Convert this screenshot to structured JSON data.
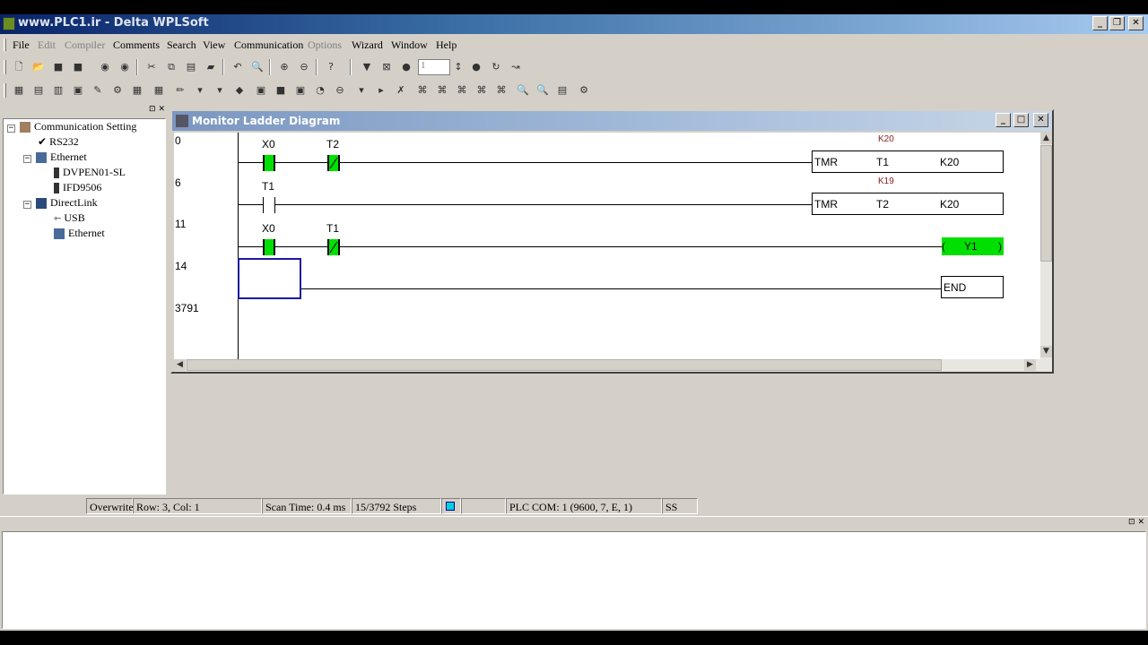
{
  "window": {
    "title": "www.PLC1.ir - Delta WPLSoft"
  },
  "menu": [
    {
      "label": "File",
      "enabled": true
    },
    {
      "label": "Edit",
      "enabled": false
    },
    {
      "label": "Compiler",
      "enabled": false
    },
    {
      "label": "Comments",
      "enabled": true
    },
    {
      "label": "Search",
      "enabled": true
    },
    {
      "label": "View",
      "enabled": true
    },
    {
      "label": "Communication",
      "enabled": true
    },
    {
      "label": "Options",
      "enabled": false
    },
    {
      "label": "Wizard",
      "enabled": true
    },
    {
      "label": "Window",
      "enabled": true
    },
    {
      "label": "Help",
      "enabled": true
    }
  ],
  "toolbar": {
    "step_value": "1"
  },
  "tree": {
    "root": "Communication Setting",
    "items": {
      "rs232": "RS232",
      "ethernet": "Ethernet",
      "dvpen": "DVPEN01-SL",
      "ifd": "IFD9506",
      "directlink": "DirectLink",
      "usb": "USB",
      "ethernet2": "Ethernet"
    }
  },
  "ladder": {
    "title": "Monitor Ladder Diagram",
    "rungs": {
      "r0": "0",
      "r1": "6",
      "r2": "11",
      "r3": "14",
      "r4": "3791"
    },
    "rung0": {
      "contact1": "X0",
      "contact2": "T2",
      "preset_value": "K20",
      "instr": "TMR",
      "operand": "T1",
      "setting": "K20"
    },
    "rung1": {
      "contact1": "T1",
      "preset_value": "K19",
      "instr": "TMR",
      "operand": "T2",
      "setting": "K20"
    },
    "rung2": {
      "contact1": "X0",
      "contact2": "T1",
      "coil": "Y1",
      "coil_left": "(",
      "coil_right": ")"
    },
    "end_label": "END"
  },
  "status": {
    "mode": "Overwrite",
    "position": "Row: 3, Col: 1",
    "scan_time": "Scan Time: 0.4 ms",
    "steps": "15/3792 Steps",
    "plc_com": "PLC COM: 1 (9600, 7, E, 1)",
    "station": "SS"
  },
  "colors": {
    "active_contact": "#00e000",
    "title_gradient_start": "#0a246a",
    "preset_text": "#8b1a1a"
  }
}
